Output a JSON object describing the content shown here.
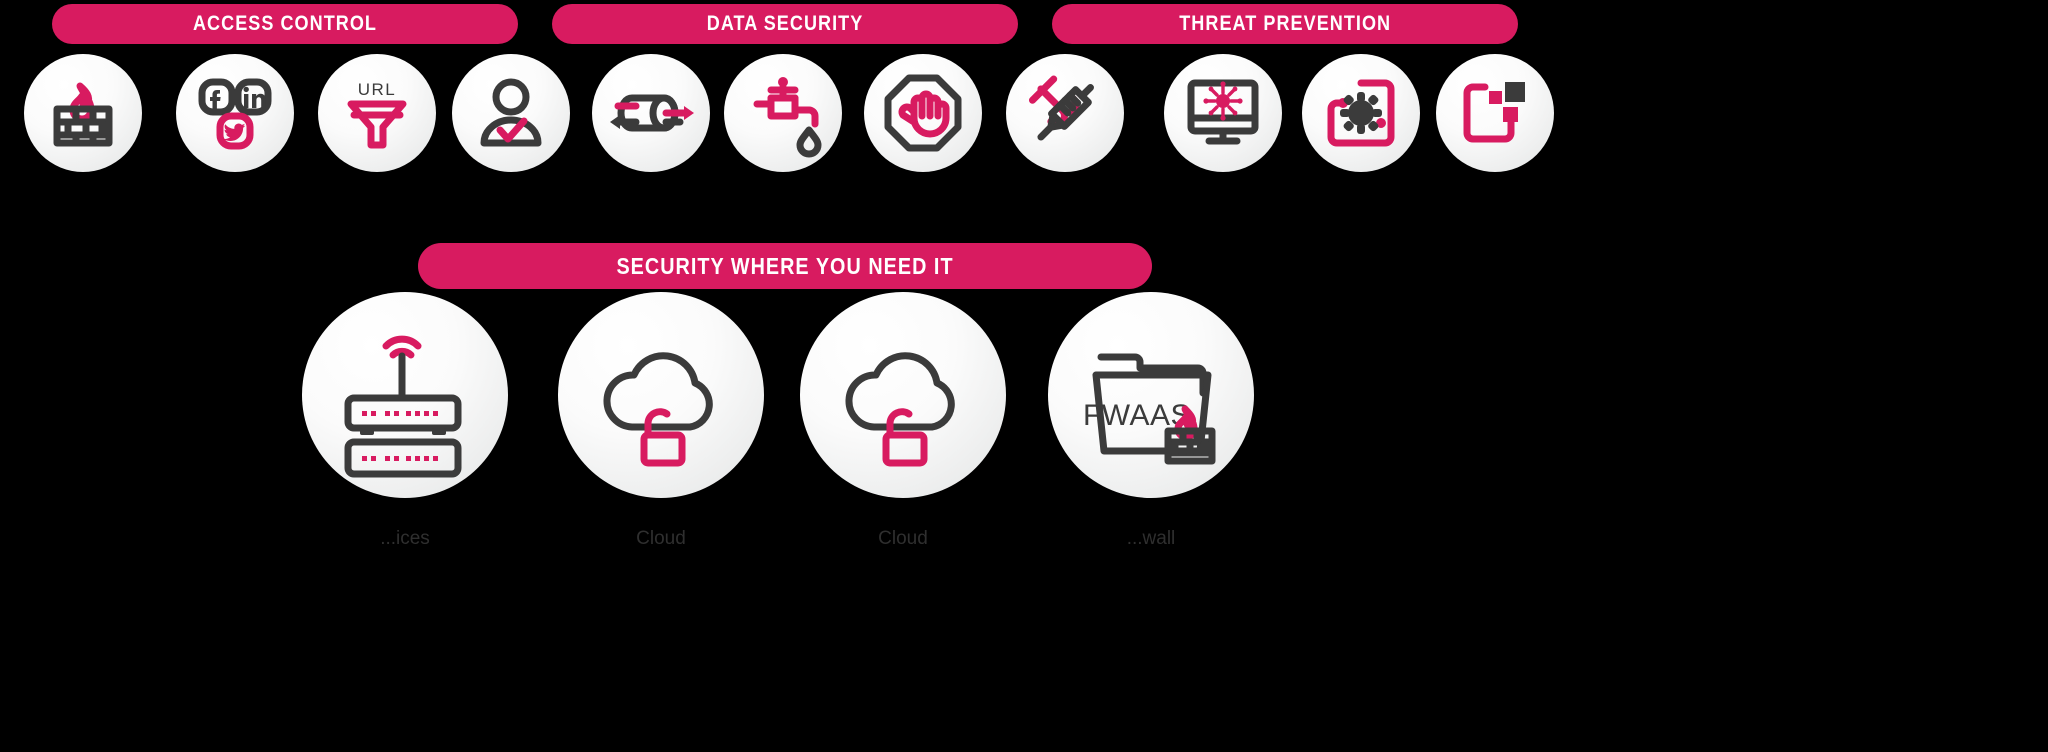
{
  "theme": {
    "background": "#000000",
    "accent_pink": "#d81b60",
    "badge_dark": "#3b3b3b",
    "badge_face": "#f3f3f3",
    "banner_text": "#ffffff"
  },
  "banners": {
    "access_control": "ACCESS CONTROL",
    "data_security": "DATA SECURITY",
    "threat_prevention": "THREAT PREVENTION",
    "security_where_you_need_it": "SECURITY WHERE YOU NEED IT"
  },
  "top_row": {
    "icons": [
      {
        "name": "firewall-icon",
        "icon": "brick-wall-flame"
      },
      {
        "name": "social-media-icon",
        "icon": "facebook-linkedin-twitter"
      },
      {
        "name": "url-filtering-icon",
        "icon": "url-funnel",
        "label": "URL"
      },
      {
        "name": "user-identity-icon",
        "icon": "user-check"
      },
      {
        "name": "data-loss-icon",
        "icon": "pipe-arrows"
      },
      {
        "name": "data-leak-icon",
        "icon": "faucet-drip"
      },
      {
        "name": "content-block-icon",
        "icon": "octagon-hand-stop"
      },
      {
        "name": "anti-virus-icon",
        "icon": "syringe-vaccine"
      },
      {
        "name": "endpoint-icon",
        "icon": "monitor-virus"
      },
      {
        "name": "sandbox-icon",
        "icon": "frame-gear-bug"
      },
      {
        "name": "patch-management-icon",
        "icon": "frame-blocks"
      }
    ]
  },
  "bottom_row": {
    "icons": [
      {
        "name": "branch-devices-icon",
        "icon": "router-switch-wifi",
        "caption": "...ices"
      },
      {
        "name": "cloud-one-icon",
        "icon": "cloud-lock",
        "caption": "Cloud"
      },
      {
        "name": "cloud-two-icon",
        "icon": "cloud-lock",
        "caption": "Cloud"
      },
      {
        "name": "fwaas-icon",
        "icon": "folder-firewall",
        "caption": "...wall",
        "label": "FWAAS"
      }
    ]
  }
}
